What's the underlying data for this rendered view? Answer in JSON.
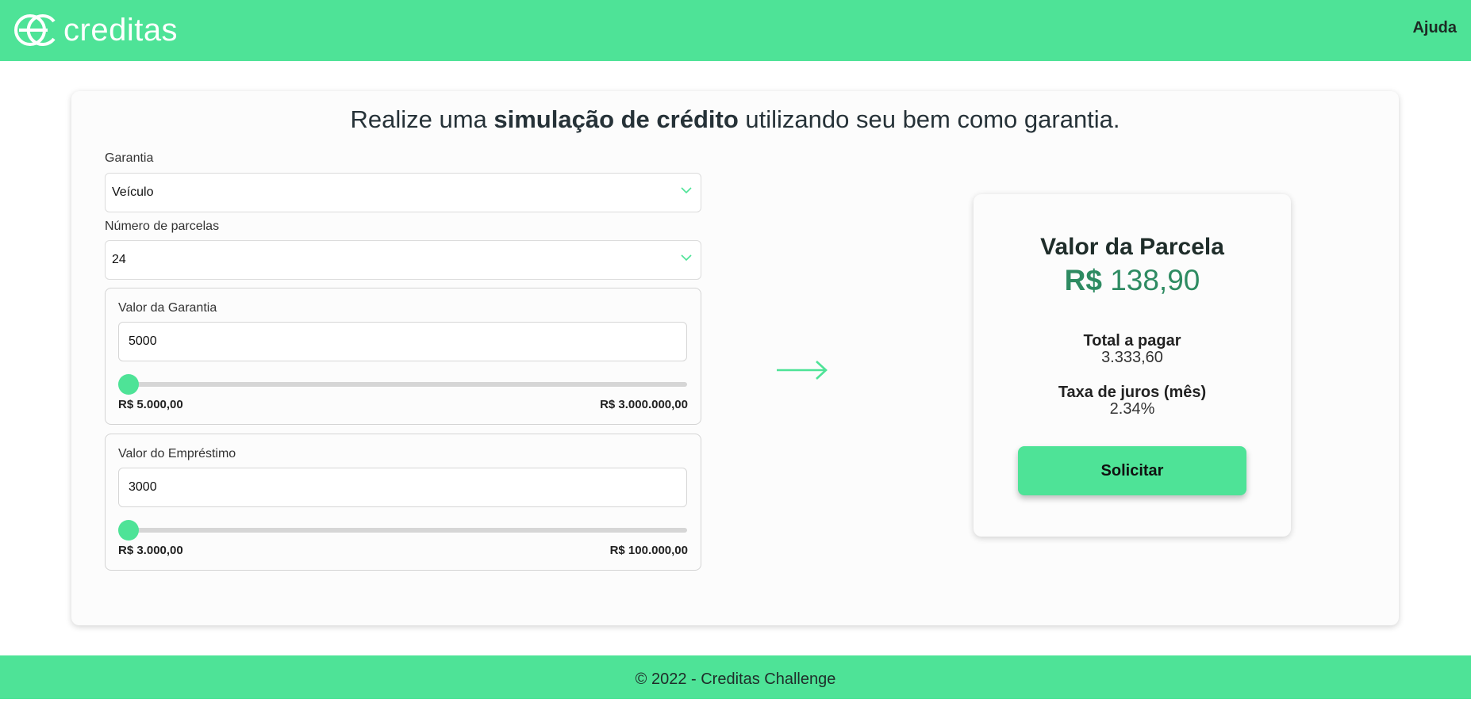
{
  "header": {
    "logo_text": "creditas",
    "help_label": "Ajuda"
  },
  "headline": {
    "prefix": "Realize uma ",
    "bold": "simulação de crédito",
    "suffix": " utilizando seu bem como garantia."
  },
  "form": {
    "guarantee": {
      "label": "Garantia",
      "value": "Veículo"
    },
    "installments": {
      "label": "Número de parcelas",
      "value": "24"
    },
    "guarantee_value": {
      "label": "Valor da Garantia",
      "input_value": "5000",
      "min_label": "R$ 5.000,00",
      "max_label": "R$ 3.000.000,00",
      "fill_fraction": 0
    },
    "loan_value": {
      "label": "Valor do Empréstimo",
      "input_value": "3000",
      "min_label": "R$ 3.000,00",
      "max_label": "R$ 100.000,00",
      "fill_fraction": 0
    }
  },
  "result": {
    "title": "Valor da Parcela",
    "currency": "R$",
    "amount": "138,90",
    "total_label": "Total a pagar",
    "total_value": "3.333,60",
    "rate_label": "Taxa de juros (mês)",
    "rate_value": "2.34%",
    "button_label": "Solicitar"
  },
  "footer": {
    "text": "© 2022 - Creditas Challenge"
  },
  "colors": {
    "brand": "#4ee397",
    "amount": "#2e8b62"
  }
}
